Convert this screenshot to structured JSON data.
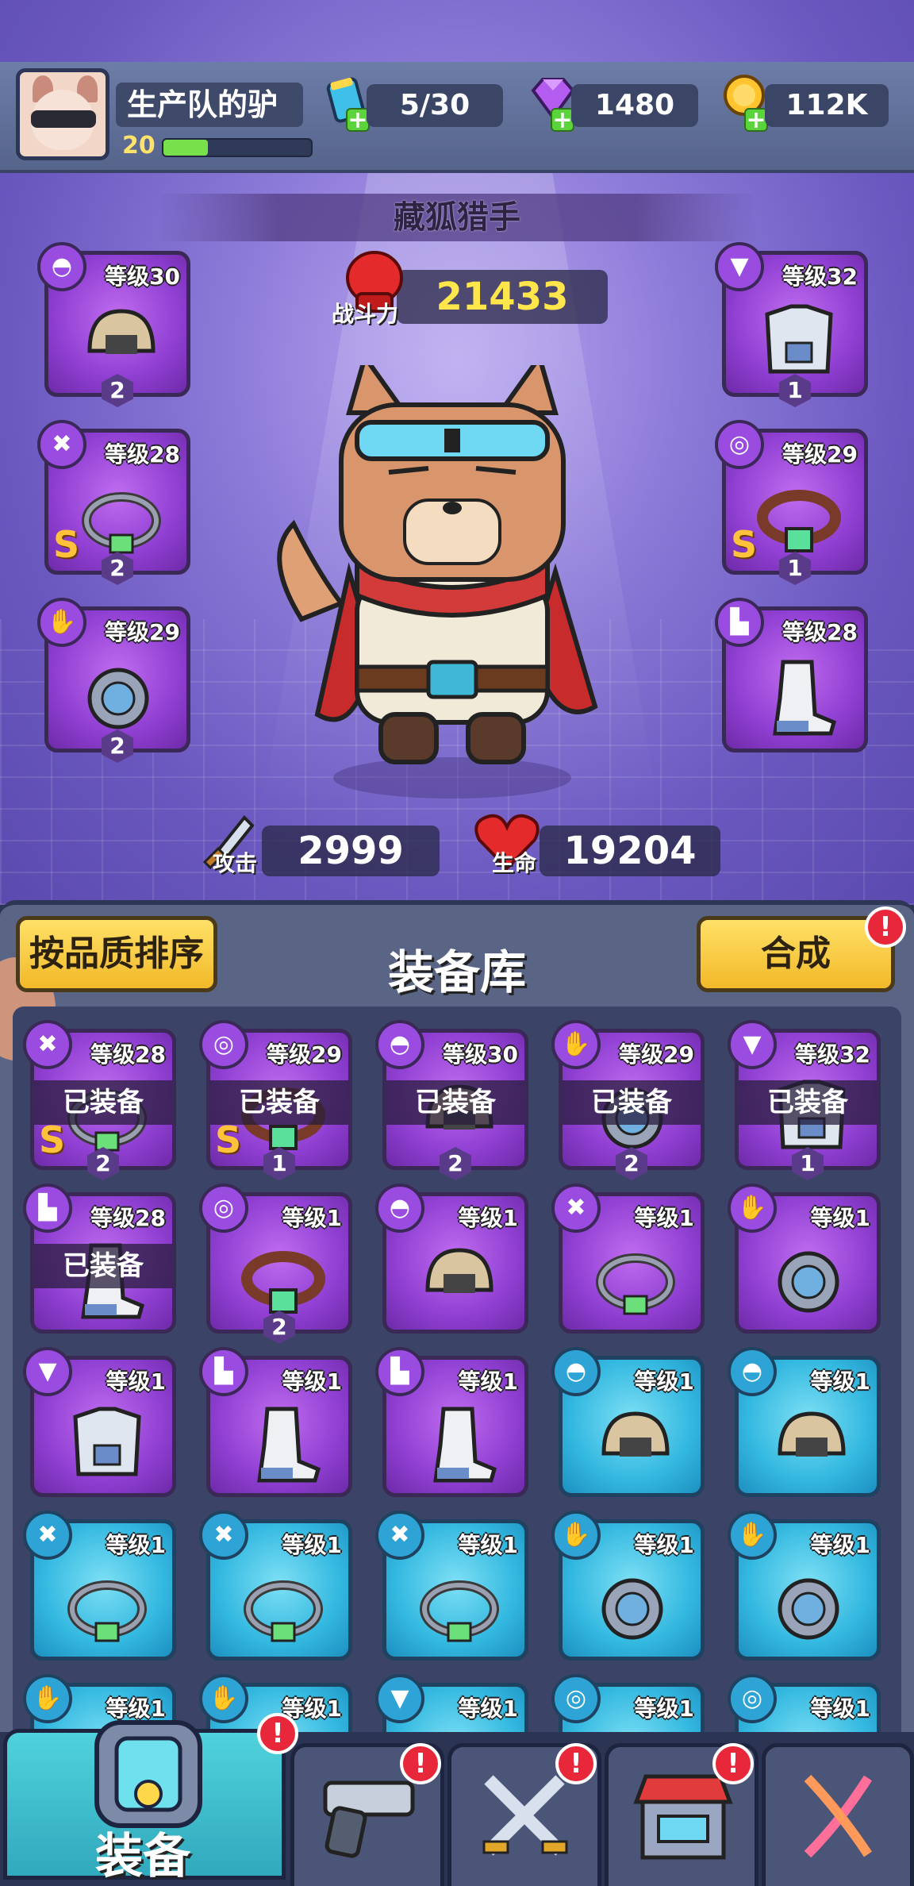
{
  "player": {
    "name": "生产队的驴",
    "level": "20",
    "xp_fraction": 0.3
  },
  "resources": {
    "energy": "5/30",
    "gems": "1480",
    "gold": "112K"
  },
  "hero": {
    "title": "藏狐猎手",
    "power_label": "战斗力",
    "power_value": "21433",
    "attack_label": "攻击",
    "attack_value": "2999",
    "hp_label": "生命",
    "hp_value": "19204"
  },
  "equipped_slots": [
    {
      "category": "helmet-icon",
      "level": "等级30",
      "stars": "2",
      "rarity": "purple"
    },
    {
      "category": "armor-icon",
      "level": "等级32",
      "stars": "1",
      "rarity": "purple"
    },
    {
      "category": "necklace-icon",
      "level": "等级28",
      "stars": "2",
      "rarity": "purple",
      "s_rank": "S"
    },
    {
      "category": "belt-icon",
      "level": "等级29",
      "stars": "1",
      "rarity": "purple",
      "s_rank": "S"
    },
    {
      "category": "glove-icon",
      "level": "等级29",
      "stars": "2",
      "rarity": "purple"
    },
    {
      "category": "boot-icon",
      "level": "等级28",
      "stars": "",
      "rarity": "purple"
    }
  ],
  "inventory": {
    "sort_button": "按品质排序",
    "title": "装备库",
    "merge_button": "合成",
    "alert_mark": "!",
    "equipped_label": "已装备",
    "items": [
      {
        "category": "necklace-icon",
        "level": "等级28",
        "stars": "2",
        "rarity": "purple",
        "equipped": true,
        "s_rank": "S"
      },
      {
        "category": "belt-icon",
        "level": "等级29",
        "stars": "1",
        "rarity": "purple",
        "equipped": true,
        "s_rank": "S"
      },
      {
        "category": "helmet-icon",
        "level": "等级30",
        "stars": "2",
        "rarity": "purple",
        "equipped": true
      },
      {
        "category": "glove-icon",
        "level": "等级29",
        "stars": "2",
        "rarity": "purple",
        "equipped": true
      },
      {
        "category": "armor-icon",
        "level": "等级32",
        "stars": "1",
        "rarity": "purple",
        "equipped": true
      },
      {
        "category": "boot-icon",
        "level": "等级28",
        "stars": "",
        "rarity": "purple",
        "equipped": true
      },
      {
        "category": "belt-icon",
        "level": "等级1",
        "stars": "2",
        "rarity": "purple"
      },
      {
        "category": "helmet-icon",
        "level": "等级1",
        "stars": "",
        "rarity": "purple"
      },
      {
        "category": "necklace-icon",
        "level": "等级1",
        "stars": "",
        "rarity": "purple"
      },
      {
        "category": "glove-icon",
        "level": "等级1",
        "stars": "",
        "rarity": "purple"
      },
      {
        "category": "armor-icon",
        "level": "等级1",
        "stars": "",
        "rarity": "purple"
      },
      {
        "category": "boot-icon",
        "level": "等级1",
        "stars": "",
        "rarity": "purple"
      },
      {
        "category": "boot-icon",
        "level": "等级1",
        "stars": "",
        "rarity": "purple"
      },
      {
        "category": "helmet-icon",
        "level": "等级1",
        "stars": "",
        "rarity": "blue"
      },
      {
        "category": "helmet-icon",
        "level": "等级1",
        "stars": "",
        "rarity": "blue"
      },
      {
        "category": "necklace-icon",
        "level": "等级1",
        "stars": "",
        "rarity": "blue"
      },
      {
        "category": "necklace-icon",
        "level": "等级1",
        "stars": "",
        "rarity": "blue"
      },
      {
        "category": "necklace-icon",
        "level": "等级1",
        "stars": "",
        "rarity": "blue"
      },
      {
        "category": "glove-icon",
        "level": "等级1",
        "stars": "",
        "rarity": "blue"
      },
      {
        "category": "glove-icon",
        "level": "等级1",
        "stars": "",
        "rarity": "blue"
      },
      {
        "category": "glove-icon",
        "level": "等级1",
        "stars": "",
        "rarity": "blue"
      },
      {
        "category": "glove-icon",
        "level": "等级1",
        "stars": "",
        "rarity": "blue"
      },
      {
        "category": "armor-icon",
        "level": "等级1",
        "stars": "",
        "rarity": "blue"
      },
      {
        "category": "belt-icon",
        "level": "等级1",
        "stars": "",
        "rarity": "blue"
      },
      {
        "category": "belt-icon",
        "level": "等级1",
        "stars": "",
        "rarity": "blue"
      }
    ]
  },
  "nav": {
    "active_label": "装备",
    "tabs": [
      "armor-icon",
      "pistol-icon",
      "crossed-swords-icon",
      "shop-icon",
      "dna-icon"
    ]
  },
  "colors": {
    "purple_rarity": "#8f3fd2",
    "blue_rarity": "#33b8e0",
    "power_text": "#ffe64a",
    "alert_red": "#e8283a"
  }
}
